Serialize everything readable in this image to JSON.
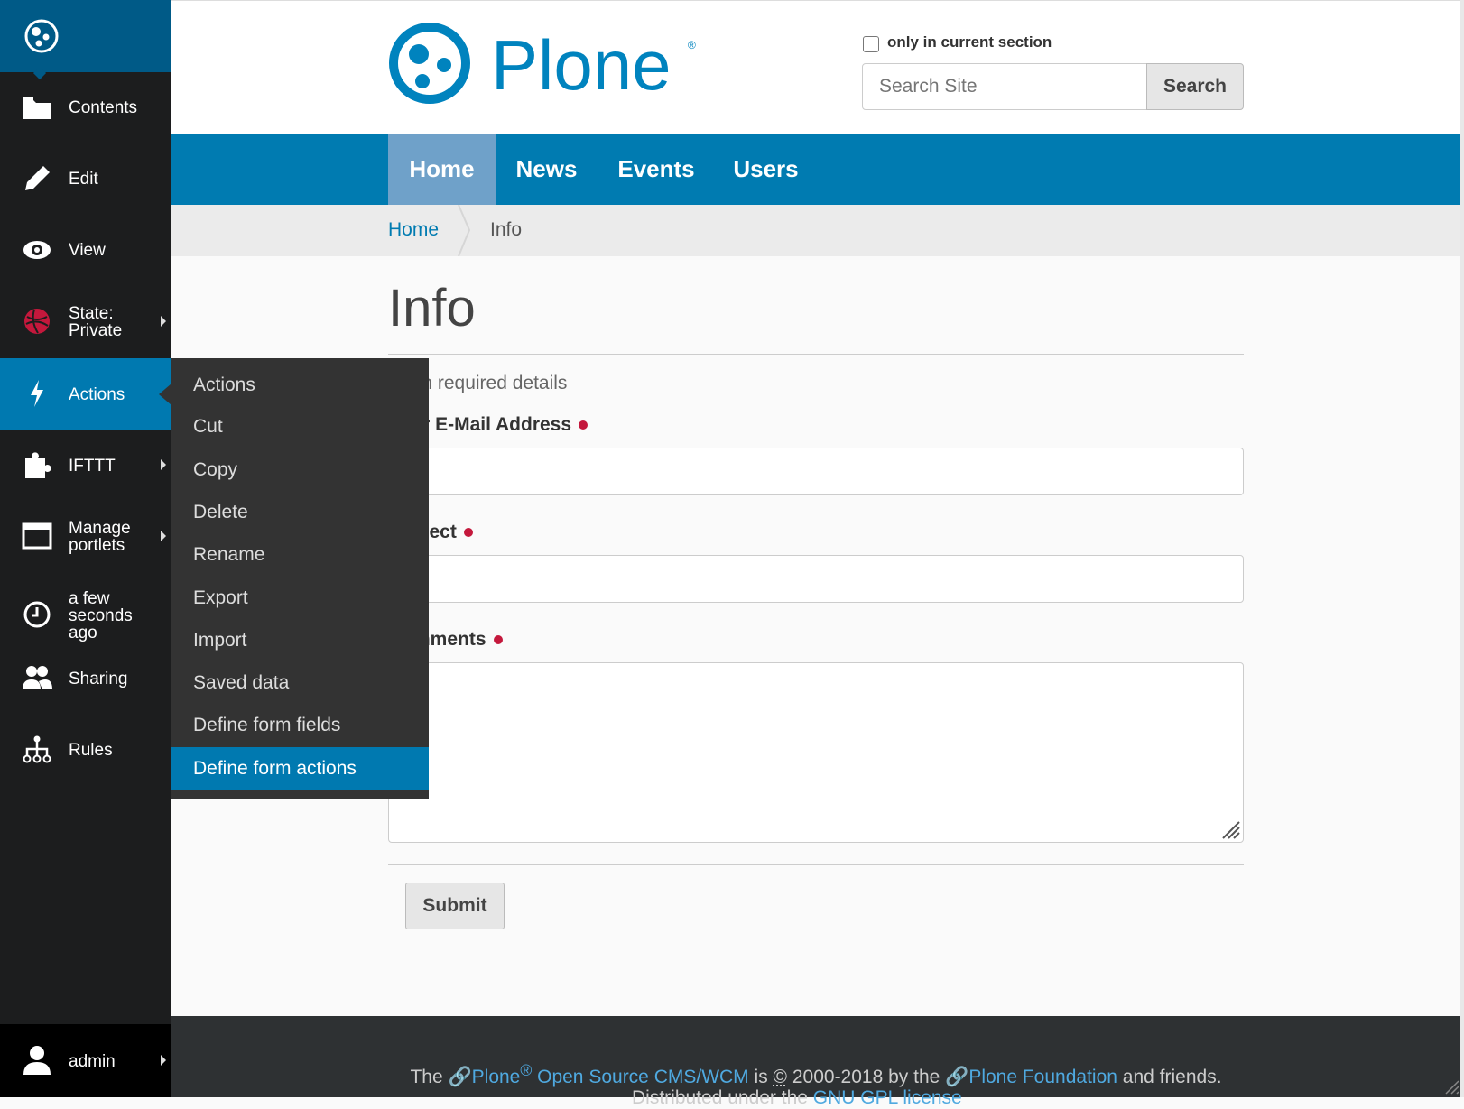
{
  "toolbar": {
    "items": [
      {
        "label": "Contents",
        "icon": "folder-icon"
      },
      {
        "label": "Edit",
        "icon": "pencil-icon"
      },
      {
        "label": "View",
        "icon": "eye-icon"
      },
      {
        "label_line1": "State:",
        "label_line2": "Private",
        "icon": "state-icon"
      },
      {
        "label": "Actions",
        "icon": "lightning-icon"
      },
      {
        "label": "IFTTT",
        "icon": "puzzle-icon"
      },
      {
        "label_line1": "Manage",
        "label_line2": "portlets",
        "icon": "window-icon"
      },
      {
        "label_line1": "a few",
        "label_line2": "seconds",
        "label_line3": "ago",
        "icon": "clock-icon"
      },
      {
        "label": "Sharing",
        "icon": "users-icon"
      },
      {
        "label": "Rules",
        "icon": "sitemap-icon"
      }
    ],
    "user": {
      "label": "admin",
      "icon": "user-icon"
    }
  },
  "search": {
    "checkbox_label": "only in current section",
    "placeholder": "Search Site",
    "button_label": "Search"
  },
  "nav": {
    "items": [
      "Home",
      "News",
      "Events",
      "Users"
    ],
    "selected": "Home"
  },
  "breadcrumbs": {
    "home": "Home",
    "current": "Info"
  },
  "main": {
    "title": "Info",
    "description": "Fill in required details",
    "fields": [
      {
        "label": "Your E-Mail Address"
      },
      {
        "label": "Subject"
      },
      {
        "label": "Comments"
      }
    ],
    "submit_label": "Submit"
  },
  "actions_menu": {
    "items": [
      "Actions",
      "Cut",
      "Copy",
      "Delete",
      "Rename",
      "Export",
      "Import",
      "Saved data",
      "Define form fields",
      "Define form actions"
    ],
    "highlighted": "Define form actions"
  },
  "footer": {
    "t1": "The ",
    "link1": "Plone",
    "reg": "®",
    "link2": " Open Source CMS/WCM",
    "t2": " is ",
    "copy": "©",
    "t3": " 2000-2018 by the ",
    "link3": "Plone Foundation",
    "t4": " and friends.",
    "line2_prefix": "Distributed under the ",
    "line2_link": "GNU GPL license"
  },
  "colors": {
    "brand_blue": "#007bb1",
    "toolbar_bg": "#1c1d1e",
    "required_red": "#c4183c"
  }
}
